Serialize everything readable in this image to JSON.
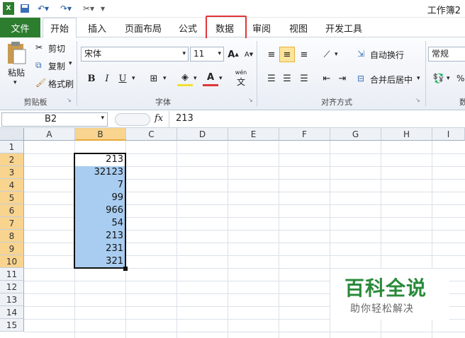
{
  "window": {
    "title": "工作簿2"
  },
  "qat": {
    "save_icon": "save-icon",
    "undo_icon": "undo-icon",
    "redo_icon": "redo-icon",
    "tool_icon": "customize-icon"
  },
  "tabs": [
    "文件",
    "开始",
    "插入",
    "页面布局",
    "公式",
    "数据",
    "审阅",
    "视图",
    "开发工具"
  ],
  "ribbon": {
    "clipboard": {
      "paste": "粘贴",
      "cut": "剪切",
      "copy": "复制",
      "format_painter": "格式刷",
      "group": "剪贴板"
    },
    "font": {
      "name": "宋体",
      "size": "11",
      "bold": "B",
      "italic": "I",
      "underline": "U",
      "group": "字体",
      "wen": "wén",
      "wen2": "文"
    },
    "alignment": {
      "wrap": "自动换行",
      "merge": "合并后居中",
      "group": "对齐方式"
    },
    "number": {
      "format": "常规",
      "percent": "%",
      "group": "数"
    }
  },
  "formula_bar": {
    "name_box": "B2",
    "fx": "fx",
    "value": "213"
  },
  "grid": {
    "columns": [
      "A",
      "B",
      "C",
      "D",
      "E",
      "F",
      "G",
      "H",
      "I"
    ],
    "rows": [
      "1",
      "2",
      "3",
      "4",
      "5",
      "6",
      "7",
      "8",
      "9",
      "10",
      "11",
      "12",
      "13",
      "14",
      "15"
    ],
    "selected_column": "B",
    "b_values": [
      "",
      "213",
      "32123",
      "7",
      "99",
      "966",
      "54",
      "213",
      "231",
      "321"
    ]
  },
  "watermark": {
    "title": "百科全说",
    "subtitle": "助你轻松解决"
  },
  "colors": {
    "file_tab": "#2d7d2f",
    "highlight": "#e0353a",
    "selection": "#a9cdf0"
  }
}
